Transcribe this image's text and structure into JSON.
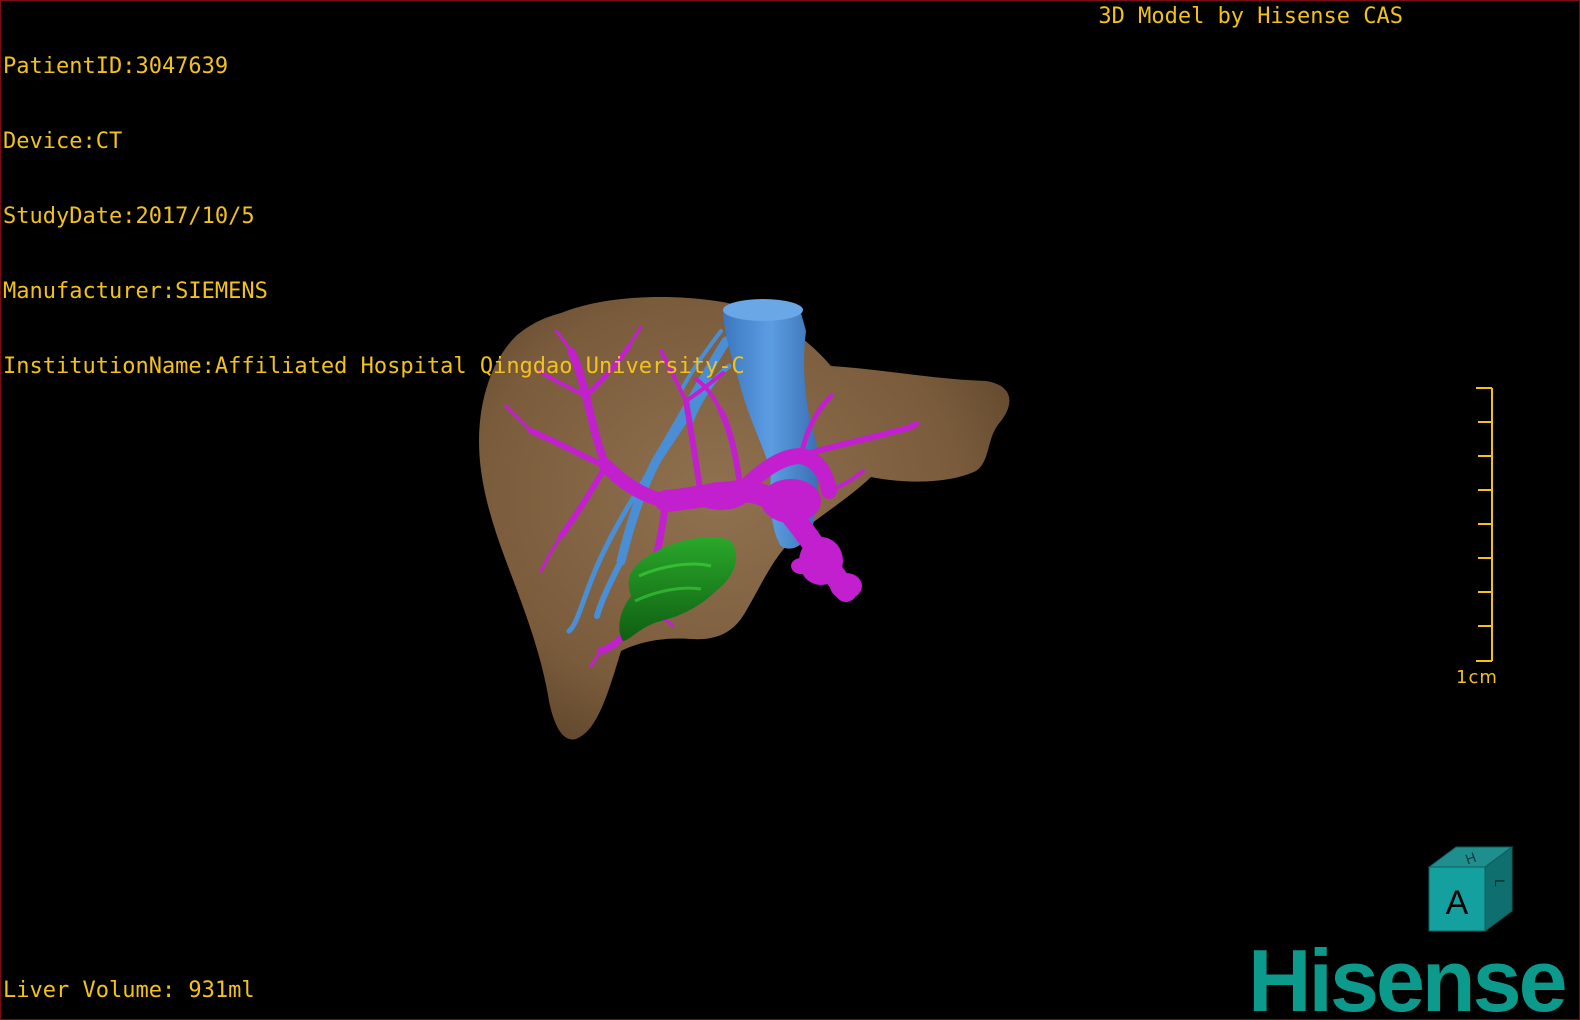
{
  "patient_info": {
    "patient_id": "PatientID:3047639",
    "device": "Device:CT",
    "study_date": "StudyDate:2017/10/5",
    "manufacturer": "Manufacturer:SIEMENS",
    "institution": "InstitutionName:Affiliated Hospital Qingdao University-C"
  },
  "credit": "3D Model by Hisense CAS",
  "liver_volume": "Liver Volume: 931ml",
  "scale_bar": {
    "label": "1cm"
  },
  "orientation_cube": {
    "front_label": "A",
    "top_label": "H",
    "side_label": "L"
  },
  "brand": {
    "logo_text": "Hisense"
  },
  "colors": {
    "overlay_text": "#f2c21b",
    "liver": "#8a6b48",
    "portal_vein": "#c21fcf",
    "hepatic_vein": "#4a8fd6",
    "gallbladder": "#1d8a1d",
    "brand": "#0b9a8c",
    "border": "#7a0e14"
  }
}
